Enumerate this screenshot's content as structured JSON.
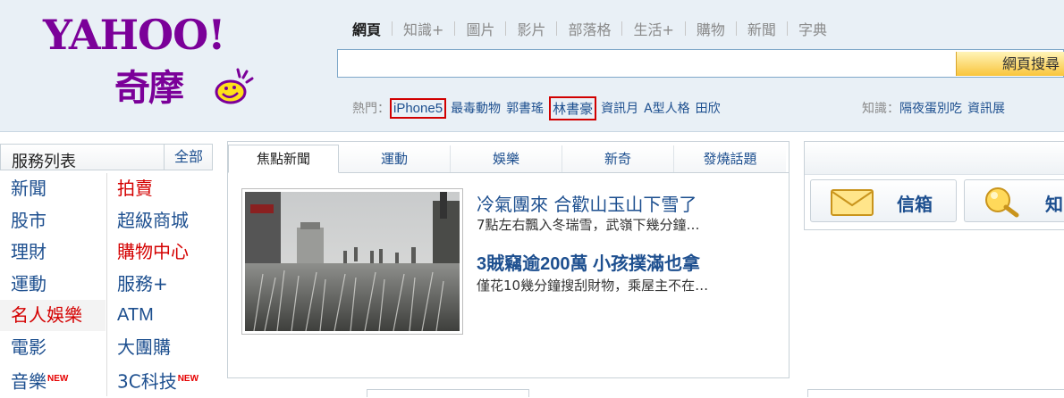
{
  "logo": {
    "en": "YAHOO!",
    "zh": "奇摩"
  },
  "search": {
    "tabs": [
      "網頁",
      "知識+",
      "圖片",
      "影片",
      "部落格",
      "生活+",
      "購物",
      "新聞",
      "字典"
    ],
    "active_tab": "網頁",
    "query": "",
    "button_label": "網頁搜尋"
  },
  "hot": {
    "label": "熱門：",
    "items": [
      "iPhone5",
      "最毒動物",
      "郭書瑤",
      "林書豪",
      "資訊月",
      "A型人格",
      "田欣"
    ],
    "boxed_items": [
      "iPhone5",
      "林書豪"
    ]
  },
  "knowledge": {
    "label": "知識：",
    "items": [
      "隔夜蛋別吃",
      "資訊展"
    ]
  },
  "service": {
    "title": "服務列表",
    "all_label": "全部",
    "left": [
      "新聞",
      "股市",
      "理財",
      "運動",
      "名人娛樂",
      "電影",
      "音樂"
    ],
    "right": [
      "拍賣",
      "超級商城",
      "購物中心",
      "服務+",
      "ATM",
      "大團購",
      "3C科技"
    ],
    "new_badge": "NEW"
  },
  "news": {
    "tabs": [
      "焦點新聞",
      "運動",
      "娛樂",
      "新奇",
      "發燒話題"
    ],
    "active_tab": "焦點新聞",
    "stories": [
      {
        "headline": "冷氣團來 合歡山玉山下雪了",
        "summary": "7點左右飄入冬瑞雪，武嶺下幾分鐘…"
      },
      {
        "headline": "3賊竊逾200萬 小孩撲滿也拿",
        "summary": "僅花10幾分鐘搜刮財物，乘屋主不在…"
      }
    ]
  },
  "right_panel": {
    "mail_label": "信箱",
    "knowledge_label": "知"
  },
  "colors": {
    "brand": "#7b0099",
    "link": "#1d4f8f",
    "alert_red": "#d40000",
    "search_button": "#f9c53c"
  }
}
